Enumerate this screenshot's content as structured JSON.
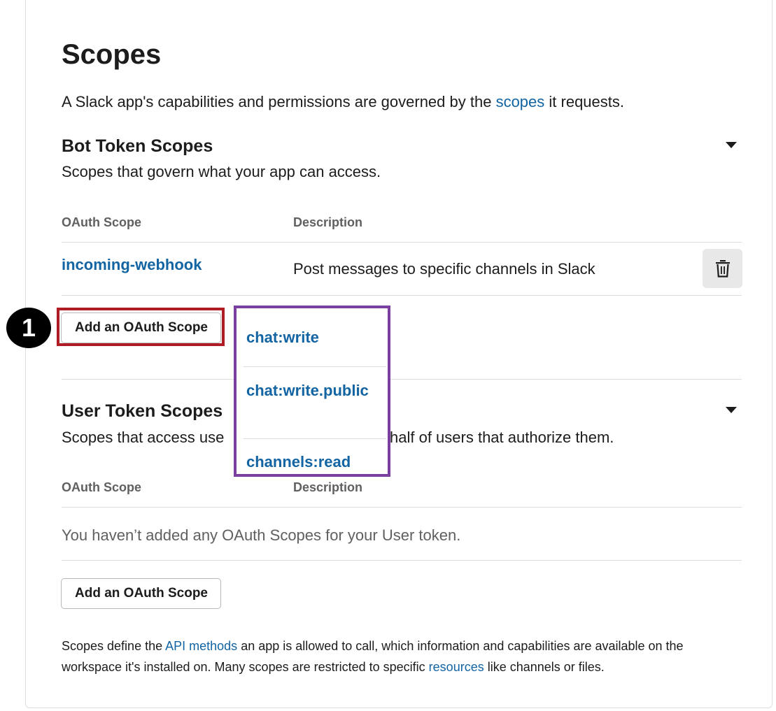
{
  "page": {
    "title": "Scopes",
    "intro_before": "A Slack app's capabilities and permissions are governed by the ",
    "intro_link": "scopes",
    "intro_after": " it requests."
  },
  "bot_scopes": {
    "title": "Bot Token Scopes",
    "subtitle": "Scopes that govern what your app can access.",
    "col_scope": "OAuth Scope",
    "col_description": "Description",
    "rows": [
      {
        "scope": "incoming-webhook",
        "description": "Post messages to specific channels in Slack",
        "action_icon": "trash-icon"
      }
    ],
    "add_button": "Add an OAuth Scope"
  },
  "annotation": {
    "step_number": "1",
    "highlight_color": "#b01c24",
    "dropdown_border_color": "#7b3fa0"
  },
  "dropdown": {
    "items": [
      "chat:write",
      "chat:write.public",
      "channels:read"
    ]
  },
  "user_scopes": {
    "title": "User Token Scopes",
    "subtitle_visible_start": "Scopes that access use",
    "subtitle_visible_end": "half of users that authorize them.",
    "col_scope": "OAuth Scope",
    "col_description": "Description",
    "empty_message": "You haven’t added any OAuth Scopes for your User token.",
    "add_button": "Add an OAuth Scope"
  },
  "footer": {
    "part1": "Scopes define the ",
    "link1": "API methods",
    "part2": " an app is allowed to call, which information and capabilities are available on the workspace it's installed on. Many scopes are restricted to specific ",
    "link2": "resources",
    "part3": " like channels or files."
  },
  "colors": {
    "link": "#1264a3",
    "text": "#1d1c1d",
    "muted": "#616061"
  }
}
